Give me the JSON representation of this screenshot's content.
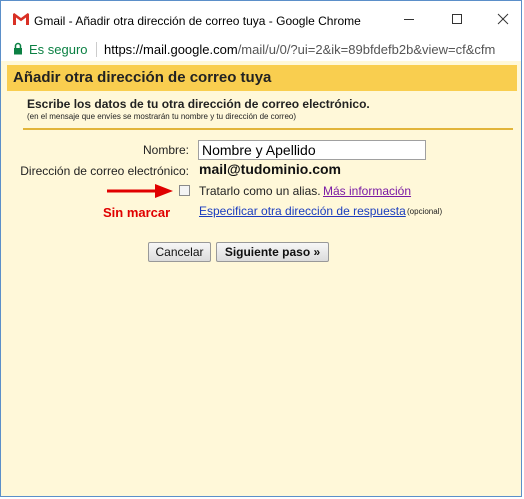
{
  "window": {
    "title": "Gmail - Añadir otra dirección de correo tuya - Google Chrome",
    "secure_label": "Es seguro",
    "url_host": "https://mail.google.com",
    "url_path": "/mail/u/0/?ui=2&ik=89bfdefb2b&view=cf&cfm"
  },
  "dialog": {
    "title": "Añadir otra dirección de correo tuya",
    "subtitle": "Escribe los datos de tu otra dirección de correo electrónico.",
    "note": "(en el mensaje que envíes se mostrarán tu nombre y tu dirección de correo)",
    "name_label": "Nombre:",
    "name_value": "Nombre y Apellido",
    "email_label": "Dirección de correo electrónico:",
    "email_value": "mail@tudominio.com",
    "alias_label": "Tratarlo como un alias.",
    "alias_checked": false,
    "more_info_link": "Más información",
    "reply_link": "Especificar otra dirección de respuesta",
    "optional_label": "(opcional)",
    "cancel_button": "Cancelar",
    "next_button": "Siguiente paso »"
  },
  "annotation": {
    "label": "Sin marcar",
    "color": "#e00000"
  },
  "colors": {
    "header_bg": "#f9ce4f",
    "dialog_bg": "#fff8d9",
    "link": "#1a3cbf",
    "visited_link": "#7a1aa5",
    "secure": "#0b8043"
  }
}
